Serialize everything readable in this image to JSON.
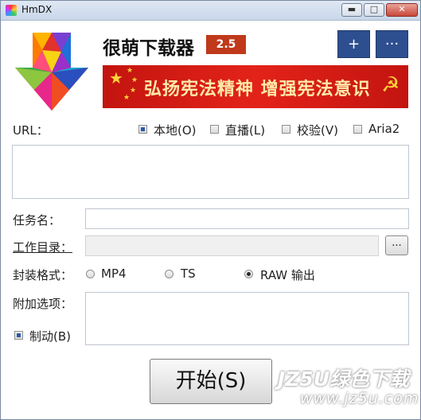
{
  "window": {
    "title": "HmDX",
    "minimize_glyph": "▬",
    "maximize_glyph": "□",
    "close_glyph": "✕"
  },
  "header": {
    "app_name": "很萌下载器",
    "version": "2.5",
    "add_glyph": "+",
    "more_glyph": "···",
    "banner_text": "弘扬宪法精神 增强宪法意识",
    "banner_color": "#d81e16",
    "accent_color": "#2e4f8f",
    "version_color": "#c0391b"
  },
  "url_row": {
    "label": "URL：",
    "options": [
      {
        "label": "本地(O)",
        "checked": true
      },
      {
        "label": "直播(L)",
        "checked": false
      },
      {
        "label": "校验(V)",
        "checked": false
      },
      {
        "label": "Aria2",
        "checked": false
      }
    ],
    "value": ""
  },
  "task_name": {
    "label": "任务名：",
    "value": ""
  },
  "work_dir": {
    "label": "工作目录：",
    "value": "",
    "browse_label": "..."
  },
  "format": {
    "label": "封装格式：",
    "options": [
      {
        "label": "MP4",
        "selected": false
      },
      {
        "label": "TS",
        "selected": false
      },
      {
        "label": "RAW 输出",
        "selected": true
      }
    ]
  },
  "extra_options": {
    "label": "附加选项：",
    "value": ""
  },
  "force": {
    "label": "制动(B)",
    "checked": true
  },
  "start_button": {
    "label": "开始(S)"
  },
  "watermark": {
    "line1": "JZ5U绿色下载",
    "line2": "www.jz5u.com"
  }
}
